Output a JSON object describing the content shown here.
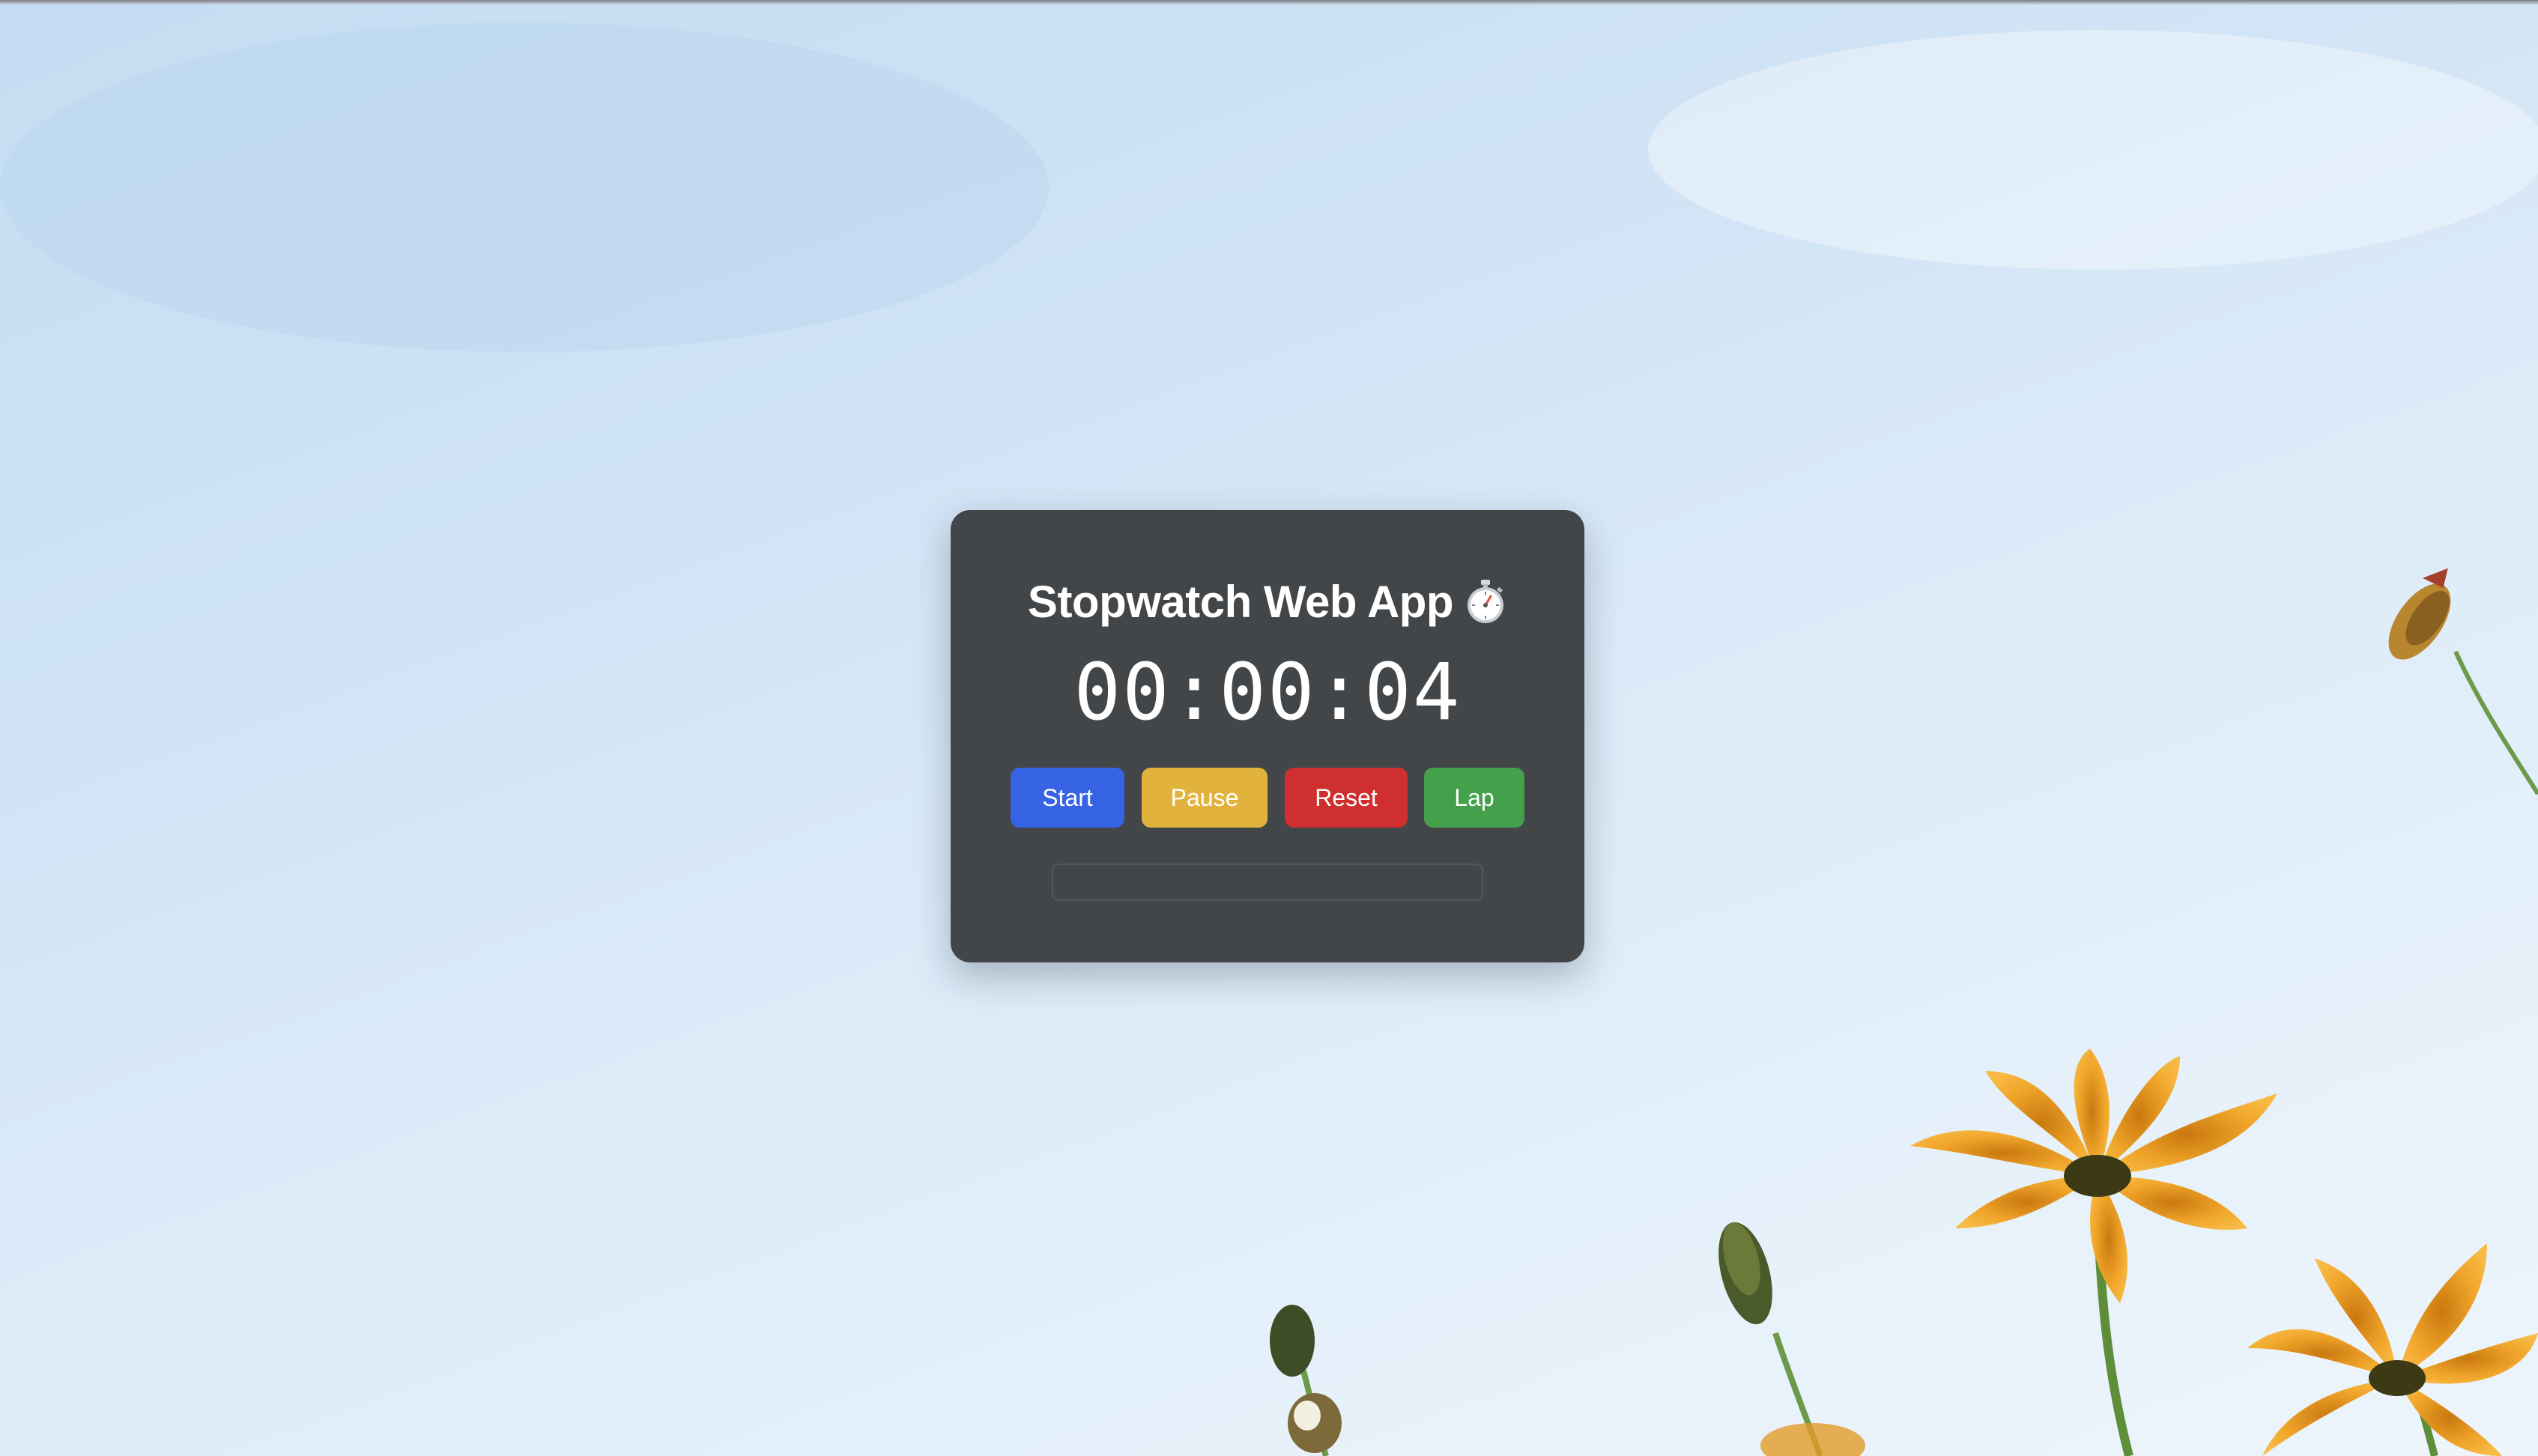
{
  "app": {
    "title": "Stopwatch Web App",
    "title_icon": "stopwatch-icon"
  },
  "display": {
    "time": "00:00:04"
  },
  "controls": {
    "start_label": "Start",
    "pause_label": "Pause",
    "reset_label": "Reset",
    "lap_label": "Lap"
  },
  "laps": [],
  "colors": {
    "card_background": "#434649",
    "start": "#3563e4",
    "pause": "#e2b33c",
    "reset": "#cf2f2f",
    "lap": "#45a04b"
  }
}
